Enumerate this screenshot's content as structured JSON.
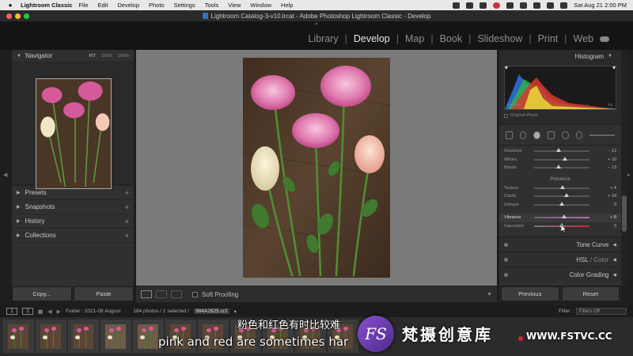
{
  "menubar": {
    "app_name": "Lightroom Classic",
    "items": [
      "File",
      "Edit",
      "Develop",
      "Photo",
      "Settings",
      "Tools",
      "View",
      "Window",
      "Help"
    ],
    "clock": "Sat Aug 21  2:00 PM"
  },
  "window": {
    "title": "Lightroom Catalog-3-v10.lrcat - Adobe Photoshop Lightroom Classic - Develop"
  },
  "modules": {
    "items": [
      "Library",
      "Develop",
      "Map",
      "Book",
      "Slideshow",
      "Print",
      "Web"
    ],
    "active": "Develop"
  },
  "left_panel": {
    "navigator": {
      "title": "Navigator",
      "zoom_fit": "FIT",
      "zoom_100": "100%",
      "zoom_200": "200%"
    },
    "sections": [
      {
        "label": "Presets",
        "action": "+"
      },
      {
        "label": "Snapshots",
        "action": "+"
      },
      {
        "label": "History",
        "action": "×"
      },
      {
        "label": "Collections",
        "action": "+"
      }
    ],
    "copy_button": "Copy...",
    "paste_button": "Paste"
  },
  "toolbar": {
    "soft_proofing": "Soft Proofing"
  },
  "right_panel": {
    "histogram": {
      "title": "Histogram",
      "iso": "ISO 200",
      "focal": "—",
      "aperture": "—",
      "shutter": "—",
      "badge": "RC",
      "original_photo": "Original Photo"
    },
    "tone_sliders": [
      {
        "label": "Shadows",
        "value": "− 12",
        "pos": 0.44
      },
      {
        "label": "Whites",
        "value": "+ 10",
        "pos": 0.56
      },
      {
        "label": "Blacks",
        "value": "− 13",
        "pos": 0.44
      }
    ],
    "presence": {
      "title": "Presence",
      "sliders": [
        {
          "label": "Texture",
          "value": "+ 4",
          "pos": 0.52
        },
        {
          "label": "Clarity",
          "value": "+ 18",
          "pos": 0.58
        },
        {
          "label": "Dehaze",
          "value": "0",
          "pos": 0.5
        },
        {
          "label": "Vibrance",
          "value": "+ 8",
          "pos": 0.54
        },
        {
          "label": "Saturation",
          "value": "0",
          "pos": 0.5
        }
      ]
    },
    "sections": [
      {
        "label": "Tone Curve",
        "suffix": ""
      },
      {
        "label": "HSL",
        "suffix": " / Color"
      },
      {
        "label": "Color Grading",
        "suffix": ""
      }
    ],
    "previous_button": "Previous",
    "reset_button": "Reset"
  },
  "filmstrip": {
    "page1": "1",
    "page2": "2",
    "folder": "Folder : 2021-08 August",
    "count": "184 photos / 1 selected /",
    "selected_file": "984A2625.cr2",
    "filter_label": "Filter :",
    "filter_value": "Filters Off"
  },
  "overlay": {
    "subtitle_cn": "粉色和红色有时比较难",
    "subtitle_en": "pink and red are sometimes har",
    "logo": "FS",
    "brand_cn": "梵摄创意库",
    "brand_url": "WWW.FSTVC.CC"
  }
}
